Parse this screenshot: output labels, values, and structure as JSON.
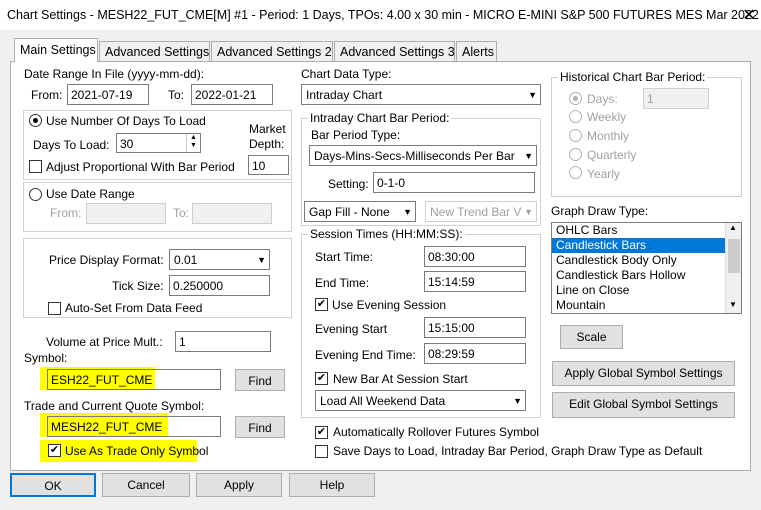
{
  "window": {
    "title": "Chart Settings - MESH22_FUT_CME[M]  #1 - Period: 1 Days, TPOs: 4.00 x 30 min   - MICRO E-MINI S&P 500 FUTURES MES Mar 2022",
    "close": "✕"
  },
  "tabs": [
    "Main Settings",
    "Advanced Settings",
    "Advanced Settings 2",
    "Advanced Settings 3",
    "Alerts"
  ],
  "date_range": {
    "label": "Date Range In File (yyyy-mm-dd):",
    "from_label": "From:",
    "from": "2021-07-19",
    "to_label": "To:",
    "to": "2022-01-21"
  },
  "days": {
    "use_label": "Use Number Of Days To Load",
    "days_label": "Days To Load:",
    "days_value": "30",
    "market_depth_label_1": "Market",
    "market_depth_label_2": "Depth:",
    "market_depth_value": "10",
    "adjust_label": "Adjust Proportional With Bar Period"
  },
  "date_range_opt": {
    "label": "Use Date Range",
    "from_label": "From:",
    "to_label": "To:"
  },
  "price": {
    "format_label": "Price Display Format:",
    "format_value": "0.01",
    "tick_label": "Tick Size:",
    "tick_value": "0.250000",
    "autoset_label": "Auto-Set From Data Feed"
  },
  "volume": {
    "label": "Volume at Price Mult.:",
    "value": "1"
  },
  "symbol": {
    "label": "Symbol:",
    "value": "ESH22_FUT_CME",
    "find": "Find"
  },
  "trade_symbol": {
    "label": "Trade and Current Quote Symbol:",
    "value": "MESH22_FUT_CME",
    "find": "Find",
    "trade_only_label": "Use As Trade Only Symbol"
  },
  "chart_data": {
    "label": "Chart Data Type:",
    "value": "Intraday Chart"
  },
  "intraday": {
    "group_label": "Intraday Chart Bar Period:",
    "bar_period_label": "Bar Period Type:",
    "bar_period_value": "Days-Mins-Secs-Milliseconds Per Bar",
    "setting_label": "Setting:",
    "setting_value": "0-1-0",
    "gap_fill": "Gap Fill - None",
    "new_trend": "New Trend Bar V"
  },
  "session": {
    "group_label": "Session Times (HH:MM:SS):",
    "start_label": "Start Time:",
    "start": "08:30:00",
    "end_label": "End Time:",
    "end": "15:14:59",
    "evening_label": "Use Evening Session",
    "evening_start_label": "Evening Start",
    "evening_start": "15:15:00",
    "evening_end_label": "Evening End Time:",
    "evening_end": "08:29:59",
    "new_bar_label": "New Bar At Session Start",
    "load_weekend": "Load All Weekend Data"
  },
  "rollover_label": "Automatically Rollover Futures Symbol",
  "save_default_label": "Save Days to Load, Intraday Bar Period, Graph Draw Type as Default",
  "historical": {
    "group_label": "Historical Chart Bar Period:",
    "options": [
      "Days:",
      "Weekly",
      "Monthly",
      "Quarterly",
      "Yearly"
    ],
    "days_value": "1"
  },
  "graph_draw": {
    "label": "Graph Draw Type:",
    "items": [
      "OHLC Bars",
      "Candlestick Bars",
      "Candlestick Body Only",
      "Candlestick Bars Hollow",
      "Line on Close",
      "Mountain"
    ],
    "selected": "Candlestick Bars"
  },
  "buttons": {
    "scale": "Scale",
    "apply_global": "Apply Global Symbol Settings",
    "edit_global": "Edit Global Symbol Settings",
    "ok": "OK",
    "cancel": "Cancel",
    "apply": "Apply",
    "help": "Help"
  },
  "highlight_color": "#ffff00",
  "selection_color": "#0078d7"
}
